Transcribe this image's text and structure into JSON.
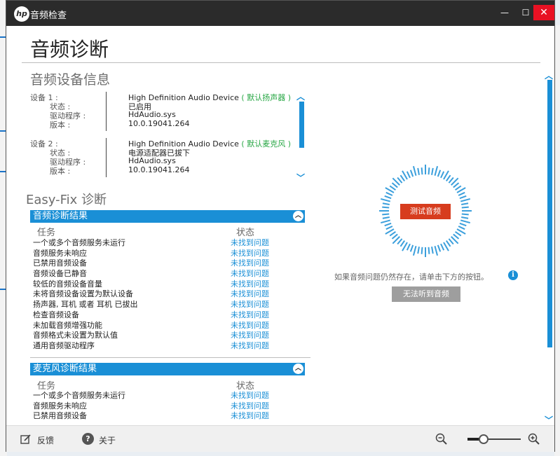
{
  "window": {
    "title": "音频检查",
    "logo": "hp",
    "controls": {
      "minimize": "—",
      "maximize": "☐",
      "close": "✕"
    }
  },
  "page_title": "音频诊断",
  "device_info": {
    "heading": "音频设备信息",
    "devices": [
      {
        "label": "设备 1 :",
        "name": "High Definition Audio Device",
        "tag": "( 默认扬声器 )",
        "state_label": "状态 :",
        "state": "已启用",
        "driver_label": "驱动程序 :",
        "driver": "HdAudio.sys",
        "version_label": "版本 :",
        "version": "10.0.19041.264"
      },
      {
        "label": "设备 2 :",
        "name": "High Definition Audio Device",
        "tag": "( 默认麦克风 )",
        "state_label": "状态 :",
        "state": "电源适配器已拔下",
        "driver_label": "驱动程序 :",
        "driver": "HdAudio.sys",
        "version_label": "版本 :",
        "version": "10.0.19041.264"
      }
    ]
  },
  "easyfix": {
    "heading": "Easy-Fix 诊断",
    "audio_results": {
      "title": "音频诊断结果",
      "col_task": "任务",
      "col_status": "状态",
      "rows": [
        {
          "task": "一个或多个音频服务未运行",
          "status": "未找到问题"
        },
        {
          "task": "音频服务未响应",
          "status": "未找到问题"
        },
        {
          "task": "已禁用音频设备",
          "status": "未找到问题"
        },
        {
          "task": "音频设备已静音",
          "status": "未找到问题"
        },
        {
          "task": "较低的音频设备音量",
          "status": "未找到问题"
        },
        {
          "task": "未将音频设备设置为默认设备",
          "status": "未找到问题"
        },
        {
          "task": "扬声器, 耳机 或者 耳机 已拔出",
          "status": "未找到问题"
        },
        {
          "task": "检查音频设备",
          "status": "未找到问题"
        },
        {
          "task": "未加载音频增强功能",
          "status": "未找到问题"
        },
        {
          "task": "音频格式未设置为默认值",
          "status": "未找到问题"
        },
        {
          "task": "通用音频驱动程序",
          "status": "未找到问题"
        }
      ]
    },
    "mic_results": {
      "title": "麦克风诊断结果",
      "col_task": "任务",
      "col_status": "状态",
      "rows": [
        {
          "task": "一个或多个音频服务未运行",
          "status": "未找到问题"
        },
        {
          "task": "音频服务未响应",
          "status": "未找到问题"
        },
        {
          "task": "已禁用音频设备",
          "status": "未找到问题"
        }
      ]
    }
  },
  "test_panel": {
    "test_button": "测试音频",
    "hint": "如果音频问题仍然存在，请单击下方的按钮。",
    "cant_hear_button": "无法听到音频"
  },
  "footer": {
    "feedback": "反馈",
    "about": "关于",
    "zoom_level": 0.3
  },
  "colors": {
    "accent": "#1a8fd6",
    "test_button": "#d73c1e",
    "ok_tag": "#28a745",
    "titlebar": "#2b2b2b"
  }
}
